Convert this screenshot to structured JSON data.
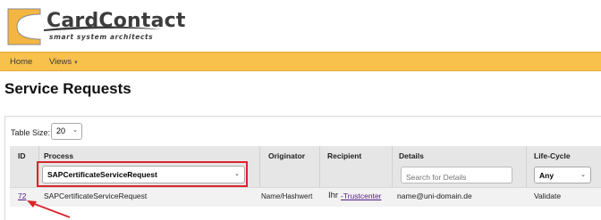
{
  "brand": {
    "name": "CardContact",
    "tagline": "smart system architects",
    "primary_color": "#f7c14c",
    "logo_color": "#f4b642"
  },
  "nav": {
    "home": "Home",
    "views": "Views"
  },
  "page": {
    "title": "Service Requests"
  },
  "table_size": {
    "label": "Table Size:",
    "value": "20"
  },
  "table": {
    "columns": {
      "id": "ID",
      "process": "Process",
      "originator": "Originator",
      "recipient": "Recipient",
      "details": "Details",
      "lifecycle": "Life-Cycle"
    },
    "filters": {
      "process": "SAPCertificateServiceRequest",
      "details_placeholder": "Search for Details",
      "lifecycle": "Any"
    },
    "rows": [
      {
        "id": "72",
        "process": "SAPCertificateServiceRequest",
        "originator": "Name/Hashwert",
        "recipient_prefix": "Ihr",
        "recipient_link": "-Trustcenter",
        "details": "name@uni-domain.de",
        "lifecycle": "Validate"
      }
    ]
  },
  "annotation_color": "#d9262c"
}
